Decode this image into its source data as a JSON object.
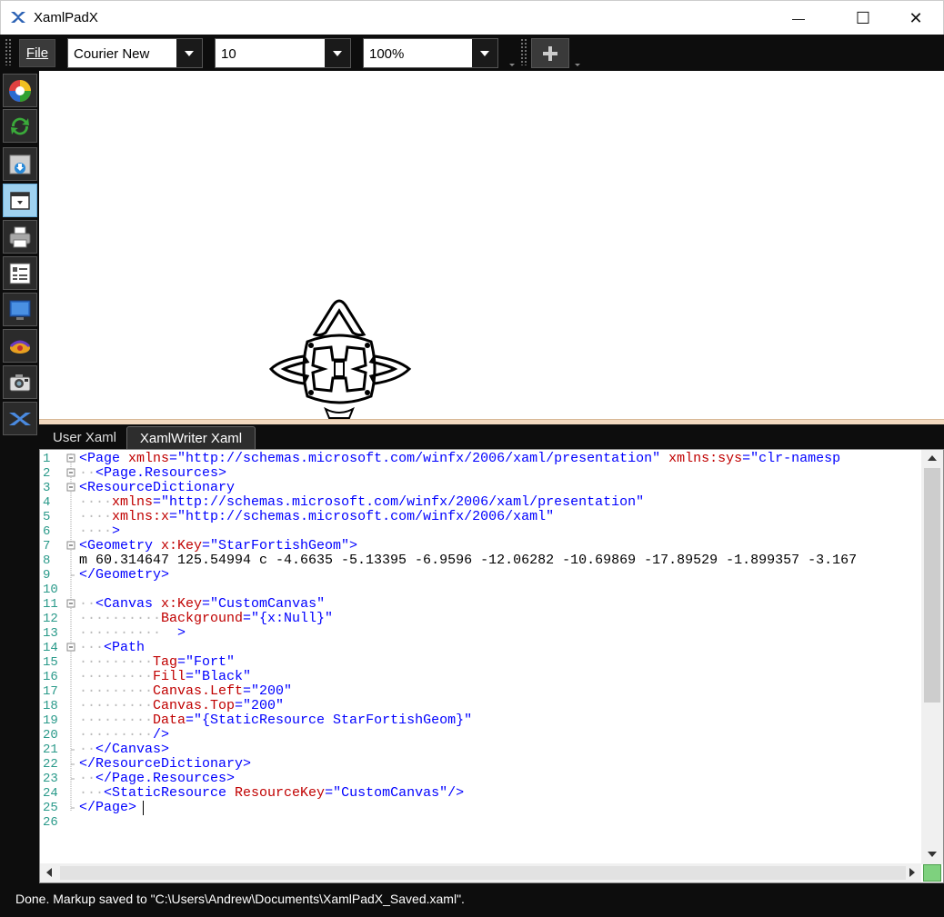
{
  "window": {
    "title": "XamlPadX",
    "minimize_glyph": "—",
    "maximize_glyph": "☐",
    "close_glyph": "✕"
  },
  "toolbar": {
    "file_label": "File",
    "font_family": "Courier New",
    "font_size": "10",
    "zoom": "100%",
    "add_icon": "plus-icon"
  },
  "sidebar": {
    "buttons": [
      {
        "icon": "color-wheel-icon"
      },
      {
        "icon": "refresh-icon"
      },
      {
        "icon": "download-icon"
      },
      {
        "icon": "panel-toggle-icon",
        "active": true
      },
      {
        "icon": "print-icon"
      },
      {
        "icon": "list-view-icon"
      },
      {
        "icon": "monitor-icon"
      },
      {
        "icon": "plugin-icon"
      },
      {
        "icon": "camera-icon"
      },
      {
        "icon": "xamlpad-logo-icon"
      }
    ]
  },
  "tabs": [
    {
      "label": "User Xaml",
      "active": false
    },
    {
      "label": "XamlWriter Xaml",
      "active": true
    }
  ],
  "editor": {
    "line_numbers": [
      "1",
      "2",
      "3",
      "4",
      "5",
      "6",
      "7",
      "8",
      "9",
      "10",
      "11",
      "12",
      "13",
      "14",
      "15",
      "16",
      "17",
      "18",
      "19",
      "20",
      "21",
      "22",
      "23",
      "24",
      "25",
      "26"
    ],
    "lines": [
      [
        [
          "b",
          "<Page "
        ],
        [
          "r",
          "xmlns"
        ],
        [
          "b",
          "=\"http://schemas.microsoft.com/winfx/2006/xaml/presentation\" "
        ],
        [
          "r",
          "xmlns:sys"
        ],
        [
          "b",
          "=\"clr-namesp"
        ]
      ],
      [
        [
          "d",
          "  "
        ],
        [
          "b",
          "<Page.Resources>"
        ]
      ],
      [
        [
          "b",
          "<ResourceDictionary"
        ]
      ],
      [
        [
          "d",
          "    "
        ],
        [
          "r",
          "xmlns"
        ],
        [
          "b",
          "=\"http://schemas.microsoft.com/winfx/2006/xaml/presentation\""
        ]
      ],
      [
        [
          "d",
          "    "
        ],
        [
          "r",
          "xmlns:x"
        ],
        [
          "b",
          "=\"http://schemas.microsoft.com/winfx/2006/xaml\""
        ]
      ],
      [
        [
          "d",
          "    "
        ],
        [
          "b",
          ">"
        ]
      ],
      [
        [
          "b",
          "<Geometry "
        ],
        [
          "r",
          "x:Key"
        ],
        [
          "b",
          "=\"StarFortishGeom\">"
        ]
      ],
      [
        [
          "k",
          "m 60.314647 125.54994 c -4.6635 -5.13395 -6.9596 -12.06282 -10.69869 -17.89529 -1.899357 -3.167"
        ]
      ],
      [
        [
          "b",
          "</Geometry>"
        ]
      ],
      [
        [
          "k",
          ""
        ]
      ],
      [
        [
          "d",
          "  "
        ],
        [
          "b",
          "<Canvas "
        ],
        [
          "r",
          "x:Key"
        ],
        [
          "b",
          "=\"CustomCanvas\""
        ]
      ],
      [
        [
          "d",
          "          "
        ],
        [
          "r",
          "Background"
        ],
        [
          "b",
          "=\"{x:Null}\""
        ]
      ],
      [
        [
          "d",
          "          "
        ],
        [
          "b",
          "  >"
        ]
      ],
      [
        [
          "d",
          "   "
        ],
        [
          "b",
          "<Path"
        ]
      ],
      [
        [
          "d",
          "         "
        ],
        [
          "r",
          "Tag"
        ],
        [
          "b",
          "=\"Fort\""
        ]
      ],
      [
        [
          "d",
          "         "
        ],
        [
          "r",
          "Fill"
        ],
        [
          "b",
          "=\"Black\""
        ]
      ],
      [
        [
          "d",
          "         "
        ],
        [
          "r",
          "Canvas.Left"
        ],
        [
          "b",
          "=\"200\""
        ]
      ],
      [
        [
          "d",
          "         "
        ],
        [
          "r",
          "Canvas.Top"
        ],
        [
          "b",
          "=\"200\""
        ]
      ],
      [
        [
          "d",
          "         "
        ],
        [
          "r",
          "Data"
        ],
        [
          "b",
          "=\"{StaticResource StarFortishGeom}\""
        ]
      ],
      [
        [
          "d",
          "         "
        ],
        [
          "b",
          "/>"
        ]
      ],
      [
        [
          "d",
          "  "
        ],
        [
          "b",
          "</Canvas>"
        ]
      ],
      [
        [
          "b",
          "</ResourceDictionary>"
        ]
      ],
      [
        [
          "d",
          "  "
        ],
        [
          "b",
          "</Page.Resources>"
        ]
      ],
      [
        [
          "d",
          "   "
        ],
        [
          "b",
          "<StaticResource "
        ],
        [
          "r",
          "ResourceKey"
        ],
        [
          "b",
          "=\"CustomCanvas\"/>"
        ]
      ],
      [
        [
          "b",
          "</Page>"
        ]
      ],
      [
        [
          "k",
          ""
        ]
      ]
    ]
  },
  "status": {
    "message": "Done. Markup saved to \"C:\\Users\\Andrew\\Documents\\XamlPadX_Saved.xaml\"."
  },
  "colors": {
    "toolbar_bg": "#0d0d0d",
    "line_number": "#2a9a8a",
    "xml_tag": "#0000ff",
    "xml_attr": "#c00000",
    "splitter": "#f2d9bf",
    "active_tool": "#9fd2f0"
  }
}
